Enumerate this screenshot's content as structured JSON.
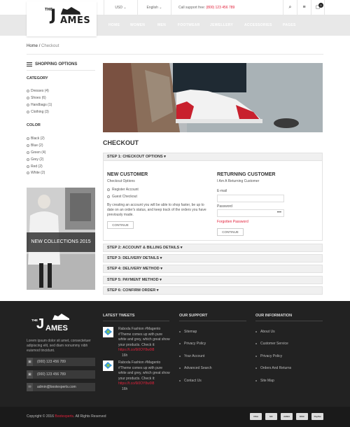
{
  "topbar": {
    "currency": "USD",
    "language": "English",
    "support_label": "Call support free:",
    "support_phone": "(800) 123 456 789",
    "cart_count": "0"
  },
  "logo": {
    "the": "THE",
    "j": "J",
    "ames": "AMES"
  },
  "nav": [
    "HOME",
    "WOMEN",
    "MEN",
    "FOOTWEAR",
    "JEWELLERY",
    "ACCESSORIES",
    "PAGES"
  ],
  "breadcrumb": {
    "home": "Home",
    "sep": "/",
    "current": "Checkout"
  },
  "sidebar": {
    "title": "SHOPPING OPTIONS",
    "category_title": "CATEGORY",
    "categories": [
      "Dresses (4)",
      "Shoes (6)",
      "Handbags (1)",
      "Clothing (3)"
    ],
    "color_title": "COLOR",
    "colors": [
      "Black (2)",
      "Blue (2)",
      "Green (4)",
      "Grey (2)",
      "Red (2)",
      "White (2)"
    ],
    "banner_text": "NEW COLLECTIONS 2015"
  },
  "checkout": {
    "title": "CHECKOUT",
    "step1": "STEP 1: CHECKOUT OPTIONS ▾",
    "new_customer_title": "NEW CUSTOMER",
    "checkout_options": "Checkout Options",
    "register": "Register Account",
    "guest": "Guest Checkout",
    "register_text_1": "By creating an account you will be able to shop faster, be up to",
    "register_text_2": "date on an order's status, and keep track of the orders you have",
    "register_text_3": "previously made.",
    "continue": "CONTINUE",
    "returning_title": "RETURNING CUSTOMER",
    "returning_sub": "I Am A Returning Customer",
    "email_label": "E-mail",
    "password_label": "Password",
    "password_value": "•••",
    "forgotten": "Forgotten Password",
    "continue2": "CONTINUE",
    "steps": [
      "STEP 2: ACCOUNT & BILLING DETAILS ▾",
      "STEP 3: DELIVERY DETAILS ▾",
      "STEP 4: DELIVERY METHOD ▾",
      "STEP 5: PAYMENT METHOD ▾",
      "STEP 6: CONFIRM ORDER ▾"
    ]
  },
  "footer": {
    "about_1": "Lorem ipsum dolor sit amet, consectetuer",
    "about_2": "adipiscing elit, sed diam nonummy nibh",
    "about_3": "euismod tincidunt.",
    "phone1": "(000) 123 456 789",
    "phone2": "(000) 123 456 789",
    "email": "admin@bootexperts.com",
    "tweets_title": "LATEST TWEETS",
    "tweets": [
      {
        "l1": "Raboda Fashion #Magento",
        "l2": "#Theme comes up with pure",
        "l3": "white and grey, which great show",
        "l4": "your products. Check it:",
        "link": "https://t.co/6i0OY8w0l8",
        "time": "16h"
      },
      {
        "l1": "Raboda Fashion #Magento",
        "l2": "#Theme comes up with pure",
        "l3": "white and grey, which great show",
        "l4": "your products. Check it:",
        "link": "https://t.co/6i0OY8w0l8",
        "time": "16h"
      }
    ],
    "support_title": "OUR SUPPORT",
    "support_links": [
      "Sitemap",
      "Privacy Policy",
      "Your Account",
      "Advanced Search",
      "Contact Us"
    ],
    "info_title": "OUR INFORMATION",
    "info_links": [
      "About Us",
      "Customer Service",
      "Privacy Policy",
      "Orders And Returns",
      "Site Map"
    ],
    "copyright_pre": "Copyright © 2016",
    "copyright_brand": "Bootexperts",
    "copyright_post": ". All Rights Reserved",
    "payments": [
      "VISA",
      "MC",
      "AMEX",
      "DISC",
      "PayPal"
    ]
  },
  "colors": {
    "accent": "#e2213b",
    "footer_bg": "#222222",
    "nav_bg": "#e8e8e8"
  }
}
